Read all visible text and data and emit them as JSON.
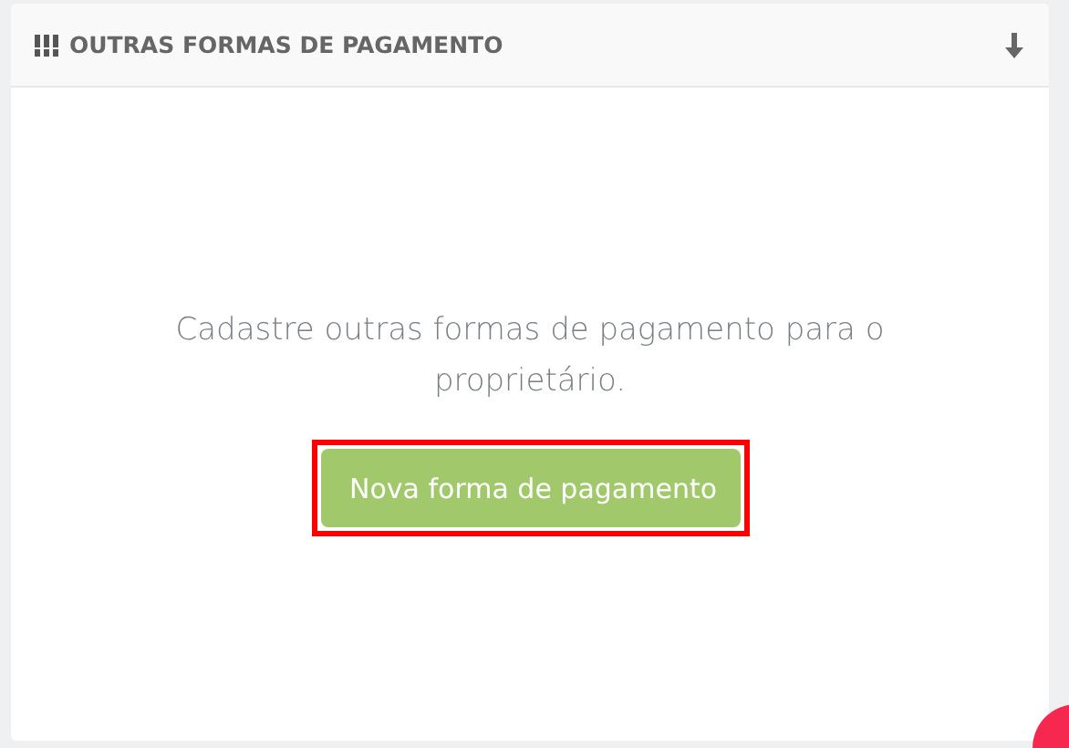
{
  "panel": {
    "title": "OUTRAS FORMAS DE PAGAMENTO",
    "message": "Cadastre outras formas de pagamento para o proprietário.",
    "button": {
      "label": "Nova forma de pagamento",
      "highlighted": true
    }
  }
}
